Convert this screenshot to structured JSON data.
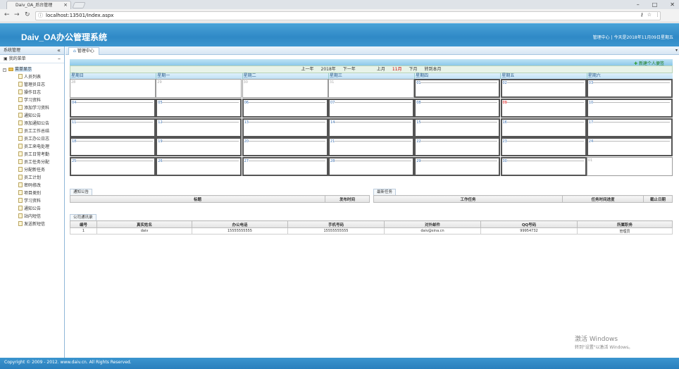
{
  "browser": {
    "tab_title": "Daiv_OA_后台管理",
    "tab_close": "×",
    "url": "localhost:13501/Index.aspx",
    "window_controls": [
      "–",
      "□",
      "✕"
    ]
  },
  "header": {
    "app_title": "Daiv_OA办公管理系统",
    "info": "管理中心 | 今天是2018年11月09日星期五"
  },
  "sidebar": {
    "title": "系统管理",
    "collapse": "«",
    "menu_title": "我的菜单",
    "menu_toggle": "–",
    "root": "菜单显示",
    "items": [
      "人员列表",
      "管理员日志",
      "操作日志",
      "学习资料",
      "添加学习资料",
      "通知公告",
      "添加通知公告",
      "员工工作总结",
      "员工办公日志",
      "员工来电处理",
      "员工日常考勤",
      "员工任务分配",
      "分配新任务",
      "员工计划",
      "密码修改",
      "项目类别",
      "学习资料",
      "通知公告",
      "站内短信",
      "发送新短信"
    ]
  },
  "main_tab": "管理中心",
  "calendar": {
    "new_personal": "新建个人便签",
    "nav": {
      "prev_year": "上一年",
      "year": "2018年",
      "next_year": "下一年",
      "prev_month": "上月",
      "month": "11月",
      "next_month": "下月",
      "today": "转到本月"
    },
    "weekdays": [
      "星期日",
      "星期一",
      "星期二",
      "星期三",
      "星期四",
      "星期五",
      "星期六"
    ],
    "weeks": [
      [
        "28",
        "29",
        "30",
        "31",
        "01",
        "02",
        "03"
      ],
      [
        "04",
        "05",
        "06",
        "07",
        "08",
        "09",
        "10"
      ],
      [
        "11",
        "12",
        "13",
        "14",
        "15",
        "16",
        "17"
      ],
      [
        "18",
        "19",
        "20",
        "21",
        "22",
        "23",
        "24"
      ],
      [
        "25",
        "26",
        "27",
        "28",
        "29",
        "30",
        "01"
      ]
    ],
    "today": "09"
  },
  "notices": {
    "tab": "通知公告",
    "headers": [
      "标题",
      "发布时间"
    ]
  },
  "tasks": {
    "tab": "最新任务",
    "headers": [
      "工作任务",
      "任务时间进度",
      "截止日期"
    ]
  },
  "contacts": {
    "tab": "公司通讯录",
    "headers": [
      "编号",
      "真实姓名",
      "办公电话",
      "手机号码",
      "对外邮件",
      "QQ号码",
      "所属职务"
    ],
    "rows": [
      [
        "1",
        "daiv",
        "15555555555",
        "15555555555",
        "daiv@sina.cn",
        "99954732",
        "管理员"
      ]
    ]
  },
  "footer": "Copyright © 2009 - 2012. www.daiv.cn. All Rights Reserved.",
  "watermark": {
    "line1": "激活 Windows",
    "line2": "转到\"设置\"以激活 Windows。"
  }
}
